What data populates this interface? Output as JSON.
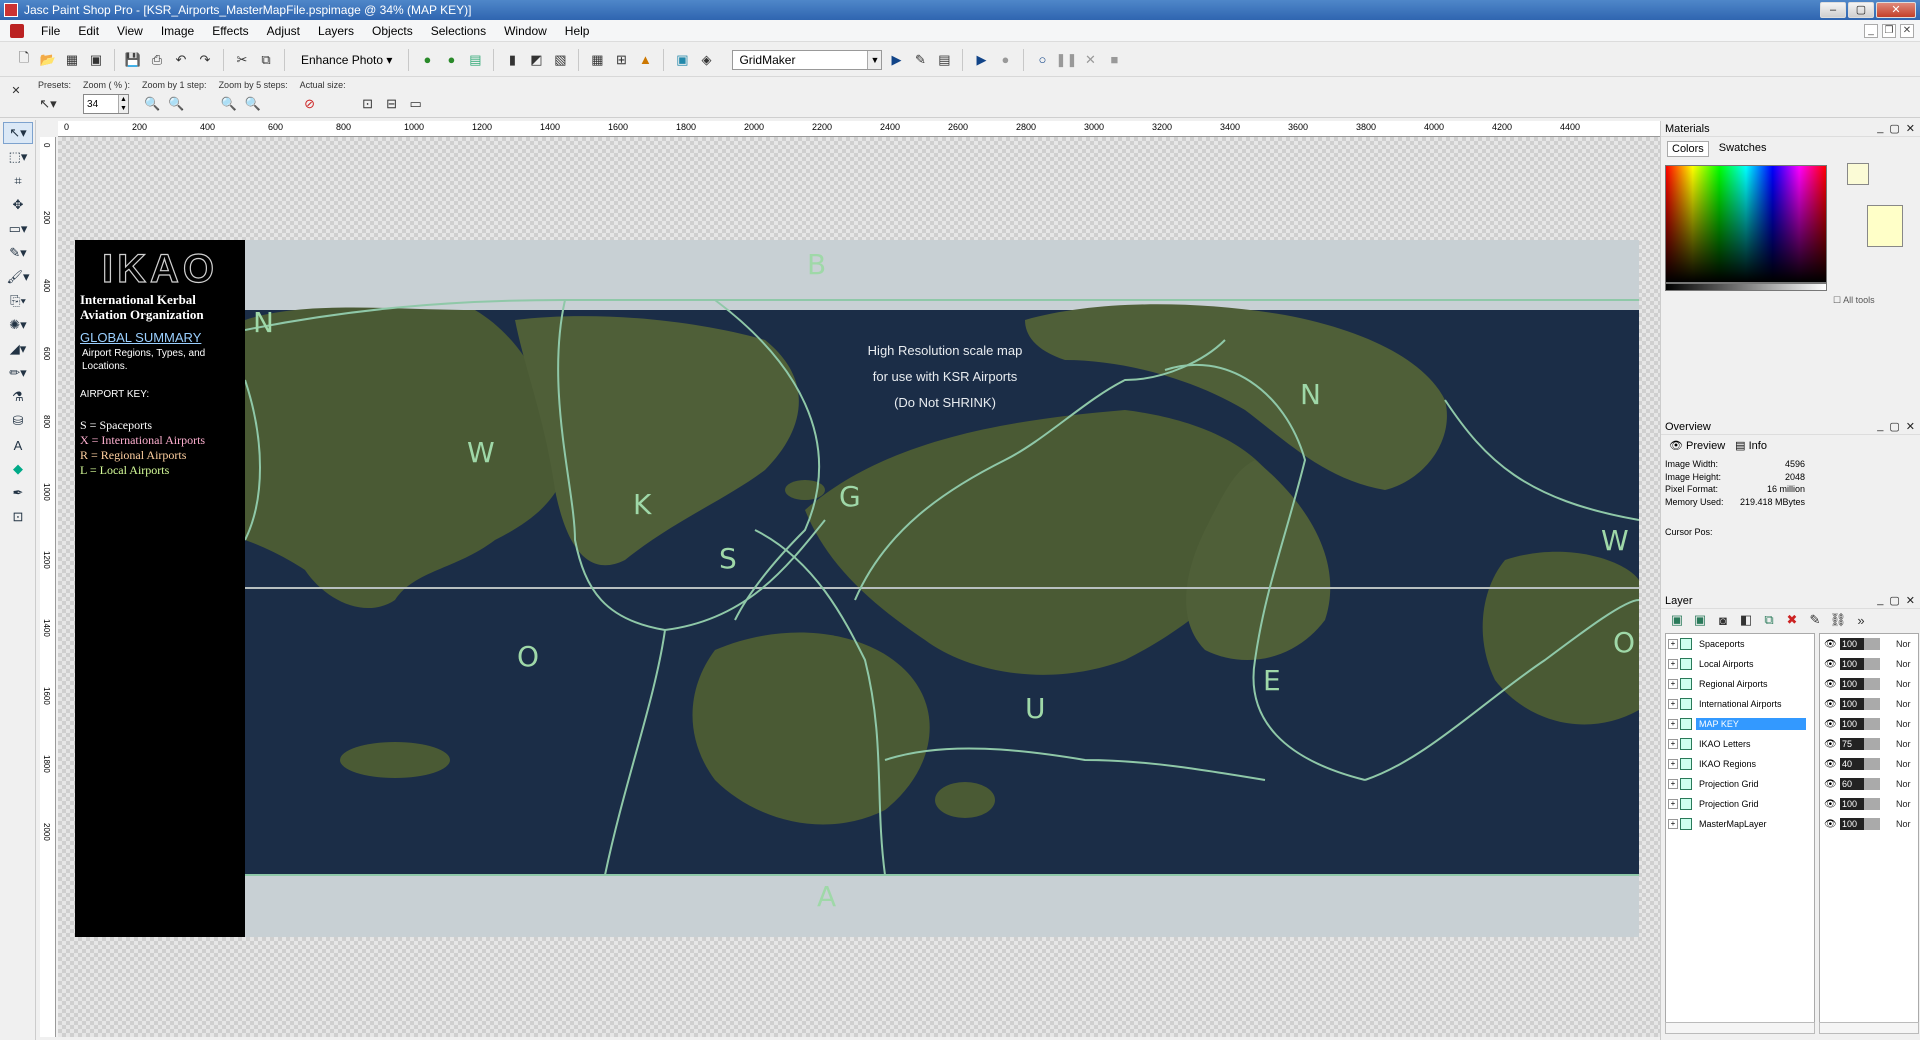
{
  "window": {
    "title": "Jasc Paint Shop Pro - [KSR_Airports_MasterMapFile.pspimage @  34% (MAP KEY)]",
    "buttons": [
      "–",
      "▢",
      "✕"
    ]
  },
  "menu": [
    "File",
    "Edit",
    "View",
    "Image",
    "Effects",
    "Adjust",
    "Layers",
    "Objects",
    "Selections",
    "Window",
    "Help"
  ],
  "toolbar": {
    "enhance_photo": "Enhance Photo",
    "script_name": "GridMaker"
  },
  "tool_options": {
    "presets_label": "Presets:",
    "zoom_label": "Zoom ( % ):",
    "zoom_value": "34",
    "zoom1_label": "Zoom by 1 step:",
    "zoom5_label": "Zoom by 5 steps:",
    "actual_label": "Actual size:"
  },
  "ruler_h": [
    "0",
    "200",
    "400",
    "600",
    "800",
    "1000",
    "1200",
    "1400",
    "1600",
    "1800",
    "2000",
    "2200",
    "2400",
    "2600",
    "2800",
    "3000",
    "3200",
    "3400",
    "3600",
    "3800",
    "4000",
    "4200",
    "4400"
  ],
  "ruler_v": [
    "0",
    "200",
    "400",
    "600",
    "800",
    "1000",
    "1200",
    "1400",
    "1600",
    "1800",
    "2000"
  ],
  "legend": {
    "logo": "IKAO",
    "org": "International Kerbal Aviation Organization",
    "summary": "GLOBAL SUMMARY",
    "summary_desc": "Airport Regions, Types, and Locations.",
    "key_title": "AIRPORT KEY:",
    "keys": [
      "S = Spaceports",
      "X = International Airports",
      "R = Regional Airports",
      "L = Local Airports"
    ]
  },
  "map": {
    "note_lines": [
      "High Resolution scale map",
      "for use with KSR Airports",
      "(Do Not SHRINK)"
    ],
    "region_letters": [
      "B",
      "N",
      "N",
      "W",
      "K",
      "G",
      "S",
      "W",
      "O",
      "O",
      "E",
      "U",
      "A"
    ],
    "colors": {
      "ocean": "#1b2d47",
      "land": "#4a5a34",
      "border": "#8fc8a8",
      "ice": "#c8d0d4"
    }
  },
  "materials": {
    "title": "Materials",
    "tabs": [
      "Colors",
      "Swatches"
    ],
    "all_tools": "All tools"
  },
  "overview": {
    "title": "Overview",
    "tabs": [
      "Preview",
      "Info"
    ],
    "info": [
      {
        "k": "Image Width:",
        "v": "4596"
      },
      {
        "k": "Image Height:",
        "v": "2048"
      },
      {
        "k": "Pixel Format:",
        "v": "16 million"
      },
      {
        "k": "Memory Used:",
        "v": "219.418 MBytes"
      }
    ],
    "cursor_pos": "Cursor Pos:"
  },
  "layers": {
    "title": "Layer",
    "items": [
      {
        "name": "Spaceports",
        "opacity": "100",
        "blend": "Nor"
      },
      {
        "name": "Local Airports",
        "opacity": "100",
        "blend": "Nor"
      },
      {
        "name": "Regional Airports",
        "opacity": "100",
        "blend": "Nor"
      },
      {
        "name": "International Airports",
        "opacity": "100",
        "blend": "Nor"
      },
      {
        "name": "MAP KEY",
        "opacity": "100",
        "blend": "Nor"
      },
      {
        "name": "IKAO Letters",
        "opacity": "75",
        "blend": "Nor"
      },
      {
        "name": "IKAO Regions",
        "opacity": "40",
        "blend": "Nor"
      },
      {
        "name": "Projection Grid",
        "opacity": "60",
        "blend": "Nor"
      },
      {
        "name": "Projection Grid",
        "opacity": "100",
        "blend": "Nor"
      },
      {
        "name": "MasterMapLayer",
        "opacity": "100",
        "blend": "Nor"
      }
    ]
  }
}
